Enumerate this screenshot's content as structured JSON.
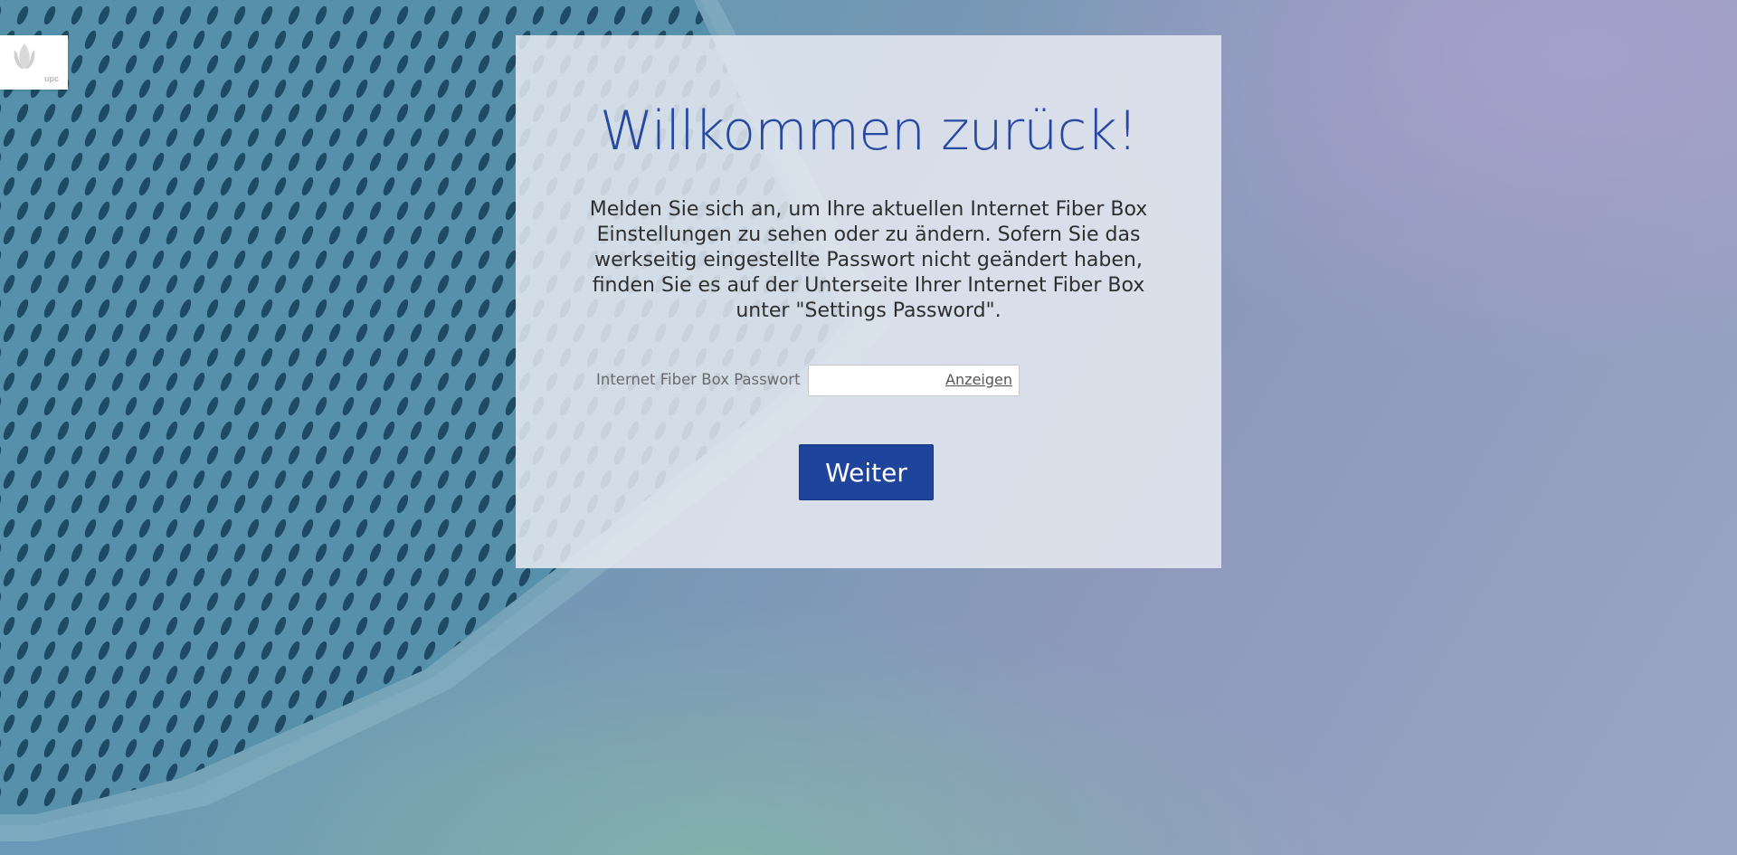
{
  "logo": {
    "text": "upc"
  },
  "login": {
    "title": "Willkommen zurück!",
    "description": "Melden Sie sich an, um Ihre aktuellen Internet Fiber Box Einstellungen zu sehen oder zu ändern. Sofern Sie das werkseitig eingestellte Passwort nicht geändert haben, finden Sie es auf der Unterseite Ihrer Internet Fiber Box unter \"Settings Password\".",
    "password_label": "Internet Fiber Box Passwort",
    "password_value": "",
    "show_label": "Anzeigen",
    "submit_label": "Weiter"
  },
  "colors": {
    "accent": "#2849a1",
    "button": "#1f449b"
  }
}
